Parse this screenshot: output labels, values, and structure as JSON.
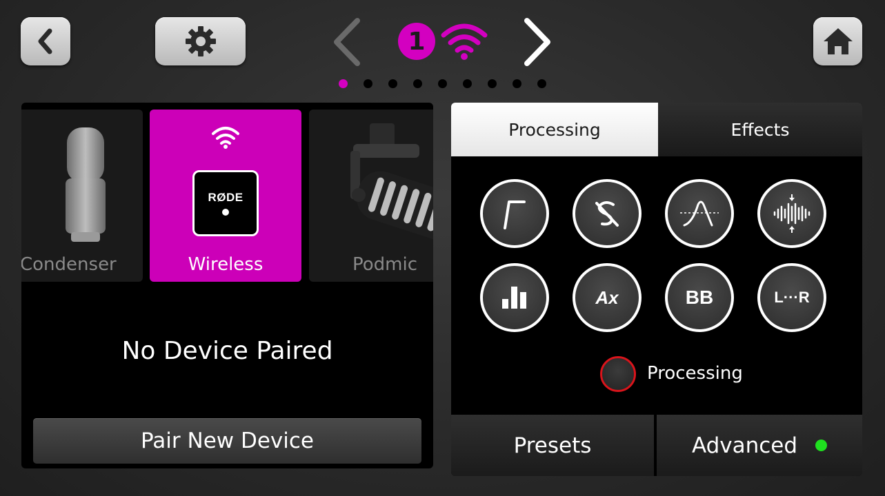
{
  "header": {
    "channel_number": "1",
    "page_count": 9,
    "active_page": 1,
    "accent_color": "#d300c0"
  },
  "sources": [
    {
      "label": "Condenser",
      "selected": false
    },
    {
      "label": "Wireless",
      "selected": true,
      "badge_text": "RØDE"
    },
    {
      "label": "Podmic",
      "selected": false
    }
  ],
  "device_status": "No Device Paired",
  "pair_button_label": "Pair New Device",
  "tabs": {
    "processing": "Processing",
    "effects": "Effects",
    "active": "processing"
  },
  "processing_buttons": [
    {
      "icon": "high-pass-filter-icon"
    },
    {
      "icon": "de-esser-icon"
    },
    {
      "icon": "noise-gate-icon"
    },
    {
      "icon": "compressor-icon"
    },
    {
      "icon": "eq-icon"
    },
    {
      "icon": "aural-exciter-icon",
      "text": "Ax"
    },
    {
      "icon": "big-bottom-icon",
      "text": "BB"
    },
    {
      "icon": "stereo-link-icon",
      "text": "L···R"
    }
  ],
  "processing_toggle": {
    "label": "Processing",
    "on": false,
    "ring_color": "#d9141b"
  },
  "footer": {
    "presets_label": "Presets",
    "advanced_label": "Advanced",
    "advanced_indicator_color": "#1fe01f"
  }
}
